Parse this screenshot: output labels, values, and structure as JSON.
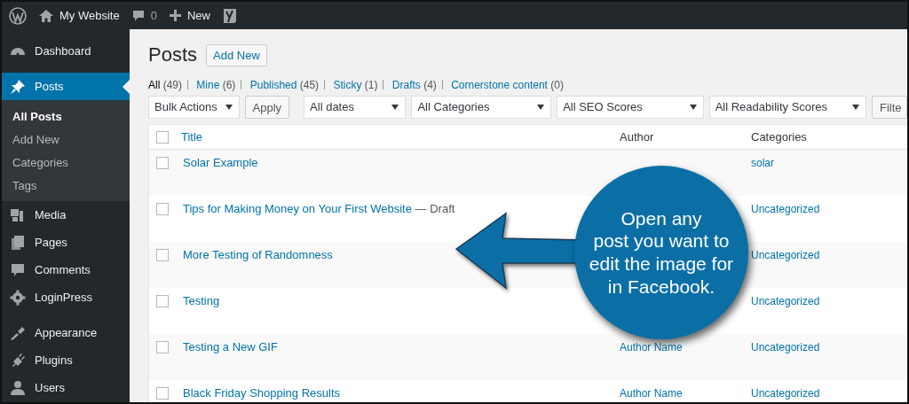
{
  "top_bar": {
    "site_name": "My Website",
    "comment_count": "0",
    "new_label": "New"
  },
  "sidebar": {
    "items": [
      {
        "kind": "dashboard",
        "label": "Dashboard",
        "selected": false
      },
      {
        "kind": "pin",
        "label": "Posts",
        "selected": true,
        "children": [
          {
            "label": "All Posts",
            "selected": true
          },
          {
            "label": "Add New",
            "selected": false
          },
          {
            "label": "Categories",
            "selected": false
          },
          {
            "label": "Tags",
            "selected": false
          }
        ]
      },
      {
        "kind": "media",
        "label": "Media",
        "selected": false
      },
      {
        "kind": "pages",
        "label": "Pages",
        "selected": false
      },
      {
        "kind": "comments",
        "label": "Comments",
        "selected": false
      },
      {
        "kind": "gear",
        "label": "LoginPress",
        "selected": false
      },
      {
        "kind": "brush",
        "label": "Appearance",
        "selected": false
      },
      {
        "kind": "plug",
        "label": "Plugins",
        "selected": false
      },
      {
        "kind": "user",
        "label": "Users",
        "selected": false
      }
    ]
  },
  "page": {
    "title": "Posts",
    "add_new": "Add New"
  },
  "views": [
    {
      "label": "All",
      "count": "(49)",
      "selected": true
    },
    {
      "label": "Mine",
      "count": "(6)",
      "selected": false
    },
    {
      "label": "Published",
      "count": "(45)",
      "selected": false
    },
    {
      "label": "Sticky",
      "count": "(1)",
      "selected": false
    },
    {
      "label": "Drafts",
      "count": "(4)",
      "selected": false
    },
    {
      "label": "Cornerstone content",
      "count": "(0)",
      "selected": false
    }
  ],
  "filters": {
    "bulk": "Bulk Actions",
    "apply": "Apply",
    "selects": [
      "All dates",
      "All Categories",
      "All SEO Scores",
      "All Readability Scores"
    ],
    "filter_button": "Filte"
  },
  "table": {
    "columns": [
      "Title",
      "Author",
      "Categories"
    ],
    "select_all_checked": false,
    "rows": [
      {
        "title": "Solar Example",
        "category": "solar",
        "checked": false
      },
      {
        "title": "Tips for Making Money on Your First Website",
        "state": "— Draft",
        "category": "Uncategorized",
        "checked": false
      },
      {
        "title": "More Testing of Randomness",
        "category": "Uncategorized",
        "checked": false
      },
      {
        "title": "Testing",
        "category": "Uncategorized",
        "checked": false
      },
      {
        "title": "Testing a New GIF",
        "author": "Author Name",
        "category": "Uncategorized",
        "checked": false
      },
      {
        "title": "Black Friday Shopping Results",
        "author": "Author Name",
        "category": "Uncategorized",
        "checked": false
      }
    ]
  },
  "callout": {
    "lines": [
      "Open any",
      "post you want to",
      "edit the image for",
      "in Facebook."
    ]
  }
}
